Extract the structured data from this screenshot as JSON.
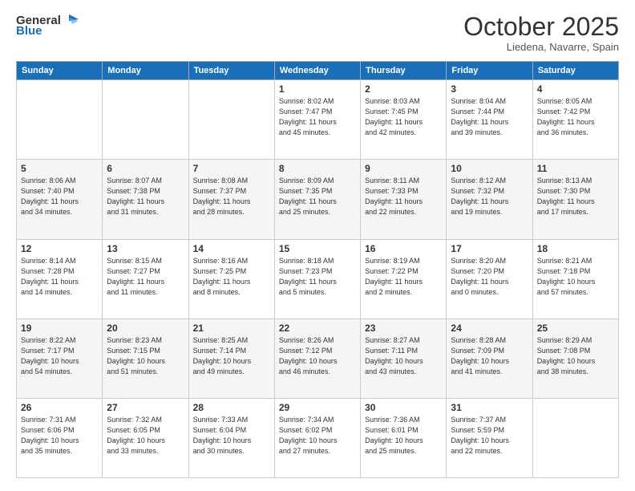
{
  "header": {
    "logo_general": "General",
    "logo_blue": "Blue",
    "month": "October 2025",
    "location": "Liedena, Navarre, Spain"
  },
  "days_of_week": [
    "Sunday",
    "Monday",
    "Tuesday",
    "Wednesday",
    "Thursday",
    "Friday",
    "Saturday"
  ],
  "weeks": [
    [
      {
        "day": "",
        "info": ""
      },
      {
        "day": "",
        "info": ""
      },
      {
        "day": "",
        "info": ""
      },
      {
        "day": "1",
        "info": "Sunrise: 8:02 AM\nSunset: 7:47 PM\nDaylight: 11 hours\nand 45 minutes."
      },
      {
        "day": "2",
        "info": "Sunrise: 8:03 AM\nSunset: 7:45 PM\nDaylight: 11 hours\nand 42 minutes."
      },
      {
        "day": "3",
        "info": "Sunrise: 8:04 AM\nSunset: 7:44 PM\nDaylight: 11 hours\nand 39 minutes."
      },
      {
        "day": "4",
        "info": "Sunrise: 8:05 AM\nSunset: 7:42 PM\nDaylight: 11 hours\nand 36 minutes."
      }
    ],
    [
      {
        "day": "5",
        "info": "Sunrise: 8:06 AM\nSunset: 7:40 PM\nDaylight: 11 hours\nand 34 minutes."
      },
      {
        "day": "6",
        "info": "Sunrise: 8:07 AM\nSunset: 7:38 PM\nDaylight: 11 hours\nand 31 minutes."
      },
      {
        "day": "7",
        "info": "Sunrise: 8:08 AM\nSunset: 7:37 PM\nDaylight: 11 hours\nand 28 minutes."
      },
      {
        "day": "8",
        "info": "Sunrise: 8:09 AM\nSunset: 7:35 PM\nDaylight: 11 hours\nand 25 minutes."
      },
      {
        "day": "9",
        "info": "Sunrise: 8:11 AM\nSunset: 7:33 PM\nDaylight: 11 hours\nand 22 minutes."
      },
      {
        "day": "10",
        "info": "Sunrise: 8:12 AM\nSunset: 7:32 PM\nDaylight: 11 hours\nand 19 minutes."
      },
      {
        "day": "11",
        "info": "Sunrise: 8:13 AM\nSunset: 7:30 PM\nDaylight: 11 hours\nand 17 minutes."
      }
    ],
    [
      {
        "day": "12",
        "info": "Sunrise: 8:14 AM\nSunset: 7:28 PM\nDaylight: 11 hours\nand 14 minutes."
      },
      {
        "day": "13",
        "info": "Sunrise: 8:15 AM\nSunset: 7:27 PM\nDaylight: 11 hours\nand 11 minutes."
      },
      {
        "day": "14",
        "info": "Sunrise: 8:16 AM\nSunset: 7:25 PM\nDaylight: 11 hours\nand 8 minutes."
      },
      {
        "day": "15",
        "info": "Sunrise: 8:18 AM\nSunset: 7:23 PM\nDaylight: 11 hours\nand 5 minutes."
      },
      {
        "day": "16",
        "info": "Sunrise: 8:19 AM\nSunset: 7:22 PM\nDaylight: 11 hours\nand 2 minutes."
      },
      {
        "day": "17",
        "info": "Sunrise: 8:20 AM\nSunset: 7:20 PM\nDaylight: 11 hours\nand 0 minutes."
      },
      {
        "day": "18",
        "info": "Sunrise: 8:21 AM\nSunset: 7:18 PM\nDaylight: 10 hours\nand 57 minutes."
      }
    ],
    [
      {
        "day": "19",
        "info": "Sunrise: 8:22 AM\nSunset: 7:17 PM\nDaylight: 10 hours\nand 54 minutes."
      },
      {
        "day": "20",
        "info": "Sunrise: 8:23 AM\nSunset: 7:15 PM\nDaylight: 10 hours\nand 51 minutes."
      },
      {
        "day": "21",
        "info": "Sunrise: 8:25 AM\nSunset: 7:14 PM\nDaylight: 10 hours\nand 49 minutes."
      },
      {
        "day": "22",
        "info": "Sunrise: 8:26 AM\nSunset: 7:12 PM\nDaylight: 10 hours\nand 46 minutes."
      },
      {
        "day": "23",
        "info": "Sunrise: 8:27 AM\nSunset: 7:11 PM\nDaylight: 10 hours\nand 43 minutes."
      },
      {
        "day": "24",
        "info": "Sunrise: 8:28 AM\nSunset: 7:09 PM\nDaylight: 10 hours\nand 41 minutes."
      },
      {
        "day": "25",
        "info": "Sunrise: 8:29 AM\nSunset: 7:08 PM\nDaylight: 10 hours\nand 38 minutes."
      }
    ],
    [
      {
        "day": "26",
        "info": "Sunrise: 7:31 AM\nSunset: 6:06 PM\nDaylight: 10 hours\nand 35 minutes."
      },
      {
        "day": "27",
        "info": "Sunrise: 7:32 AM\nSunset: 6:05 PM\nDaylight: 10 hours\nand 33 minutes."
      },
      {
        "day": "28",
        "info": "Sunrise: 7:33 AM\nSunset: 6:04 PM\nDaylight: 10 hours\nand 30 minutes."
      },
      {
        "day": "29",
        "info": "Sunrise: 7:34 AM\nSunset: 6:02 PM\nDaylight: 10 hours\nand 27 minutes."
      },
      {
        "day": "30",
        "info": "Sunrise: 7:36 AM\nSunset: 6:01 PM\nDaylight: 10 hours\nand 25 minutes."
      },
      {
        "day": "31",
        "info": "Sunrise: 7:37 AM\nSunset: 5:59 PM\nDaylight: 10 hours\nand 22 minutes."
      },
      {
        "day": "",
        "info": ""
      }
    ]
  ]
}
